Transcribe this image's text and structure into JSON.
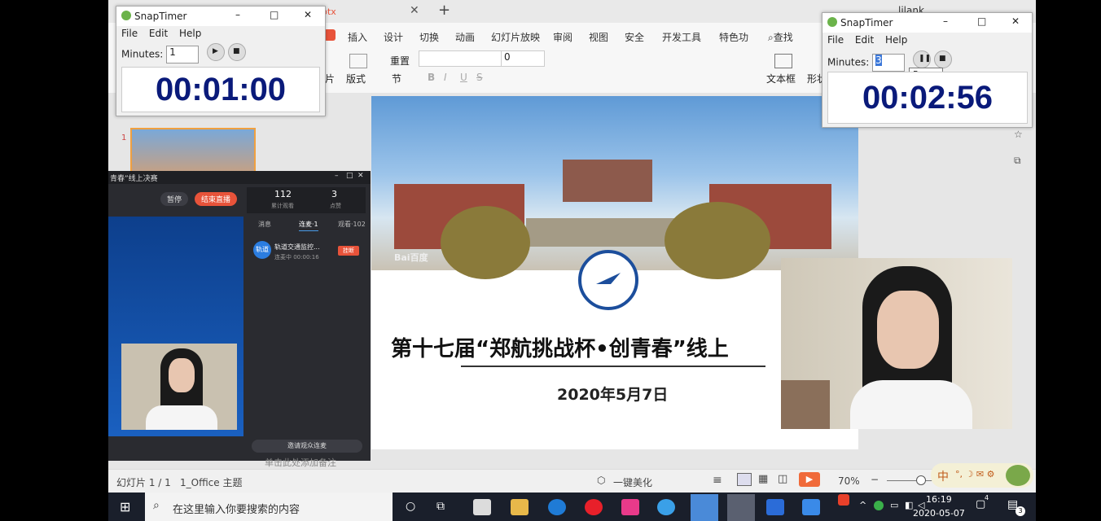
{
  "wps": {
    "tab_file_suffix": "ptx",
    "new_tab": "+",
    "ribbon_tabs": [
      "插入",
      "设计",
      "切换",
      "动画",
      "幻灯片放映",
      "审阅",
      "视图",
      "安全",
      "开发工具",
      "特色功",
      "查找"
    ],
    "font_size": "0",
    "ribbon_labels": {
      "reset": "重置",
      "layout": "版式",
      "section": "节",
      "textbox": "文本框",
      "shape": "形状",
      "pic": "片"
    },
    "user": "lilank"
  },
  "slide": {
    "title": "第十七届“郑航挑战杯•创青春”线上",
    "date": "2020年5月7日",
    "watermark": "Bai百度"
  },
  "thumb": {
    "number": "1"
  },
  "snap_left": {
    "app": "SnapTimer",
    "menu": [
      "File",
      "Edit",
      "Help"
    ],
    "minutes_label": "Minutes:",
    "minutes_value": "1",
    "time": "00:01:00"
  },
  "snap_right": {
    "app": "SnapTimer",
    "menu": [
      "File",
      "Edit",
      "Help"
    ],
    "minutes_label": "Minutes:",
    "minutes_value": "3",
    "time": "00:02:56",
    "tooltip": "Pause"
  },
  "live": {
    "title": "青春”线上决赛",
    "pause": "暂停",
    "end": "结束直播",
    "viewers": "112",
    "viewers_label": "累计观看",
    "likes": "3",
    "likes_label": "点赞",
    "tabs": [
      "消息",
      "连麦·1",
      "观看·102"
    ],
    "caller_name": "轨道交通监控...",
    "caller_status": "连麦中 00:00:16",
    "caller_avatar": "轨道",
    "hangup": "挂断",
    "invite": "邀请观众连麦"
  },
  "status": {
    "slide_info": "幻灯片 1 / 1",
    "theme": "1_Office 主题",
    "notes": "单击此处添加备注",
    "beautify": "一键美化",
    "zoom": "70%",
    "ime": "中",
    "minus": "−",
    "plus": "+"
  },
  "taskbar": {
    "search_placeholder": "在这里输入你要搜索的内容",
    "time": "16:19",
    "date": "2020-05-07",
    "notif_count": "3",
    "task_count": "4"
  },
  "colors": {
    "accent_red": "#e8533a",
    "timer_blue": "#0a1a7a",
    "taskbar": "#1a1f2b"
  }
}
